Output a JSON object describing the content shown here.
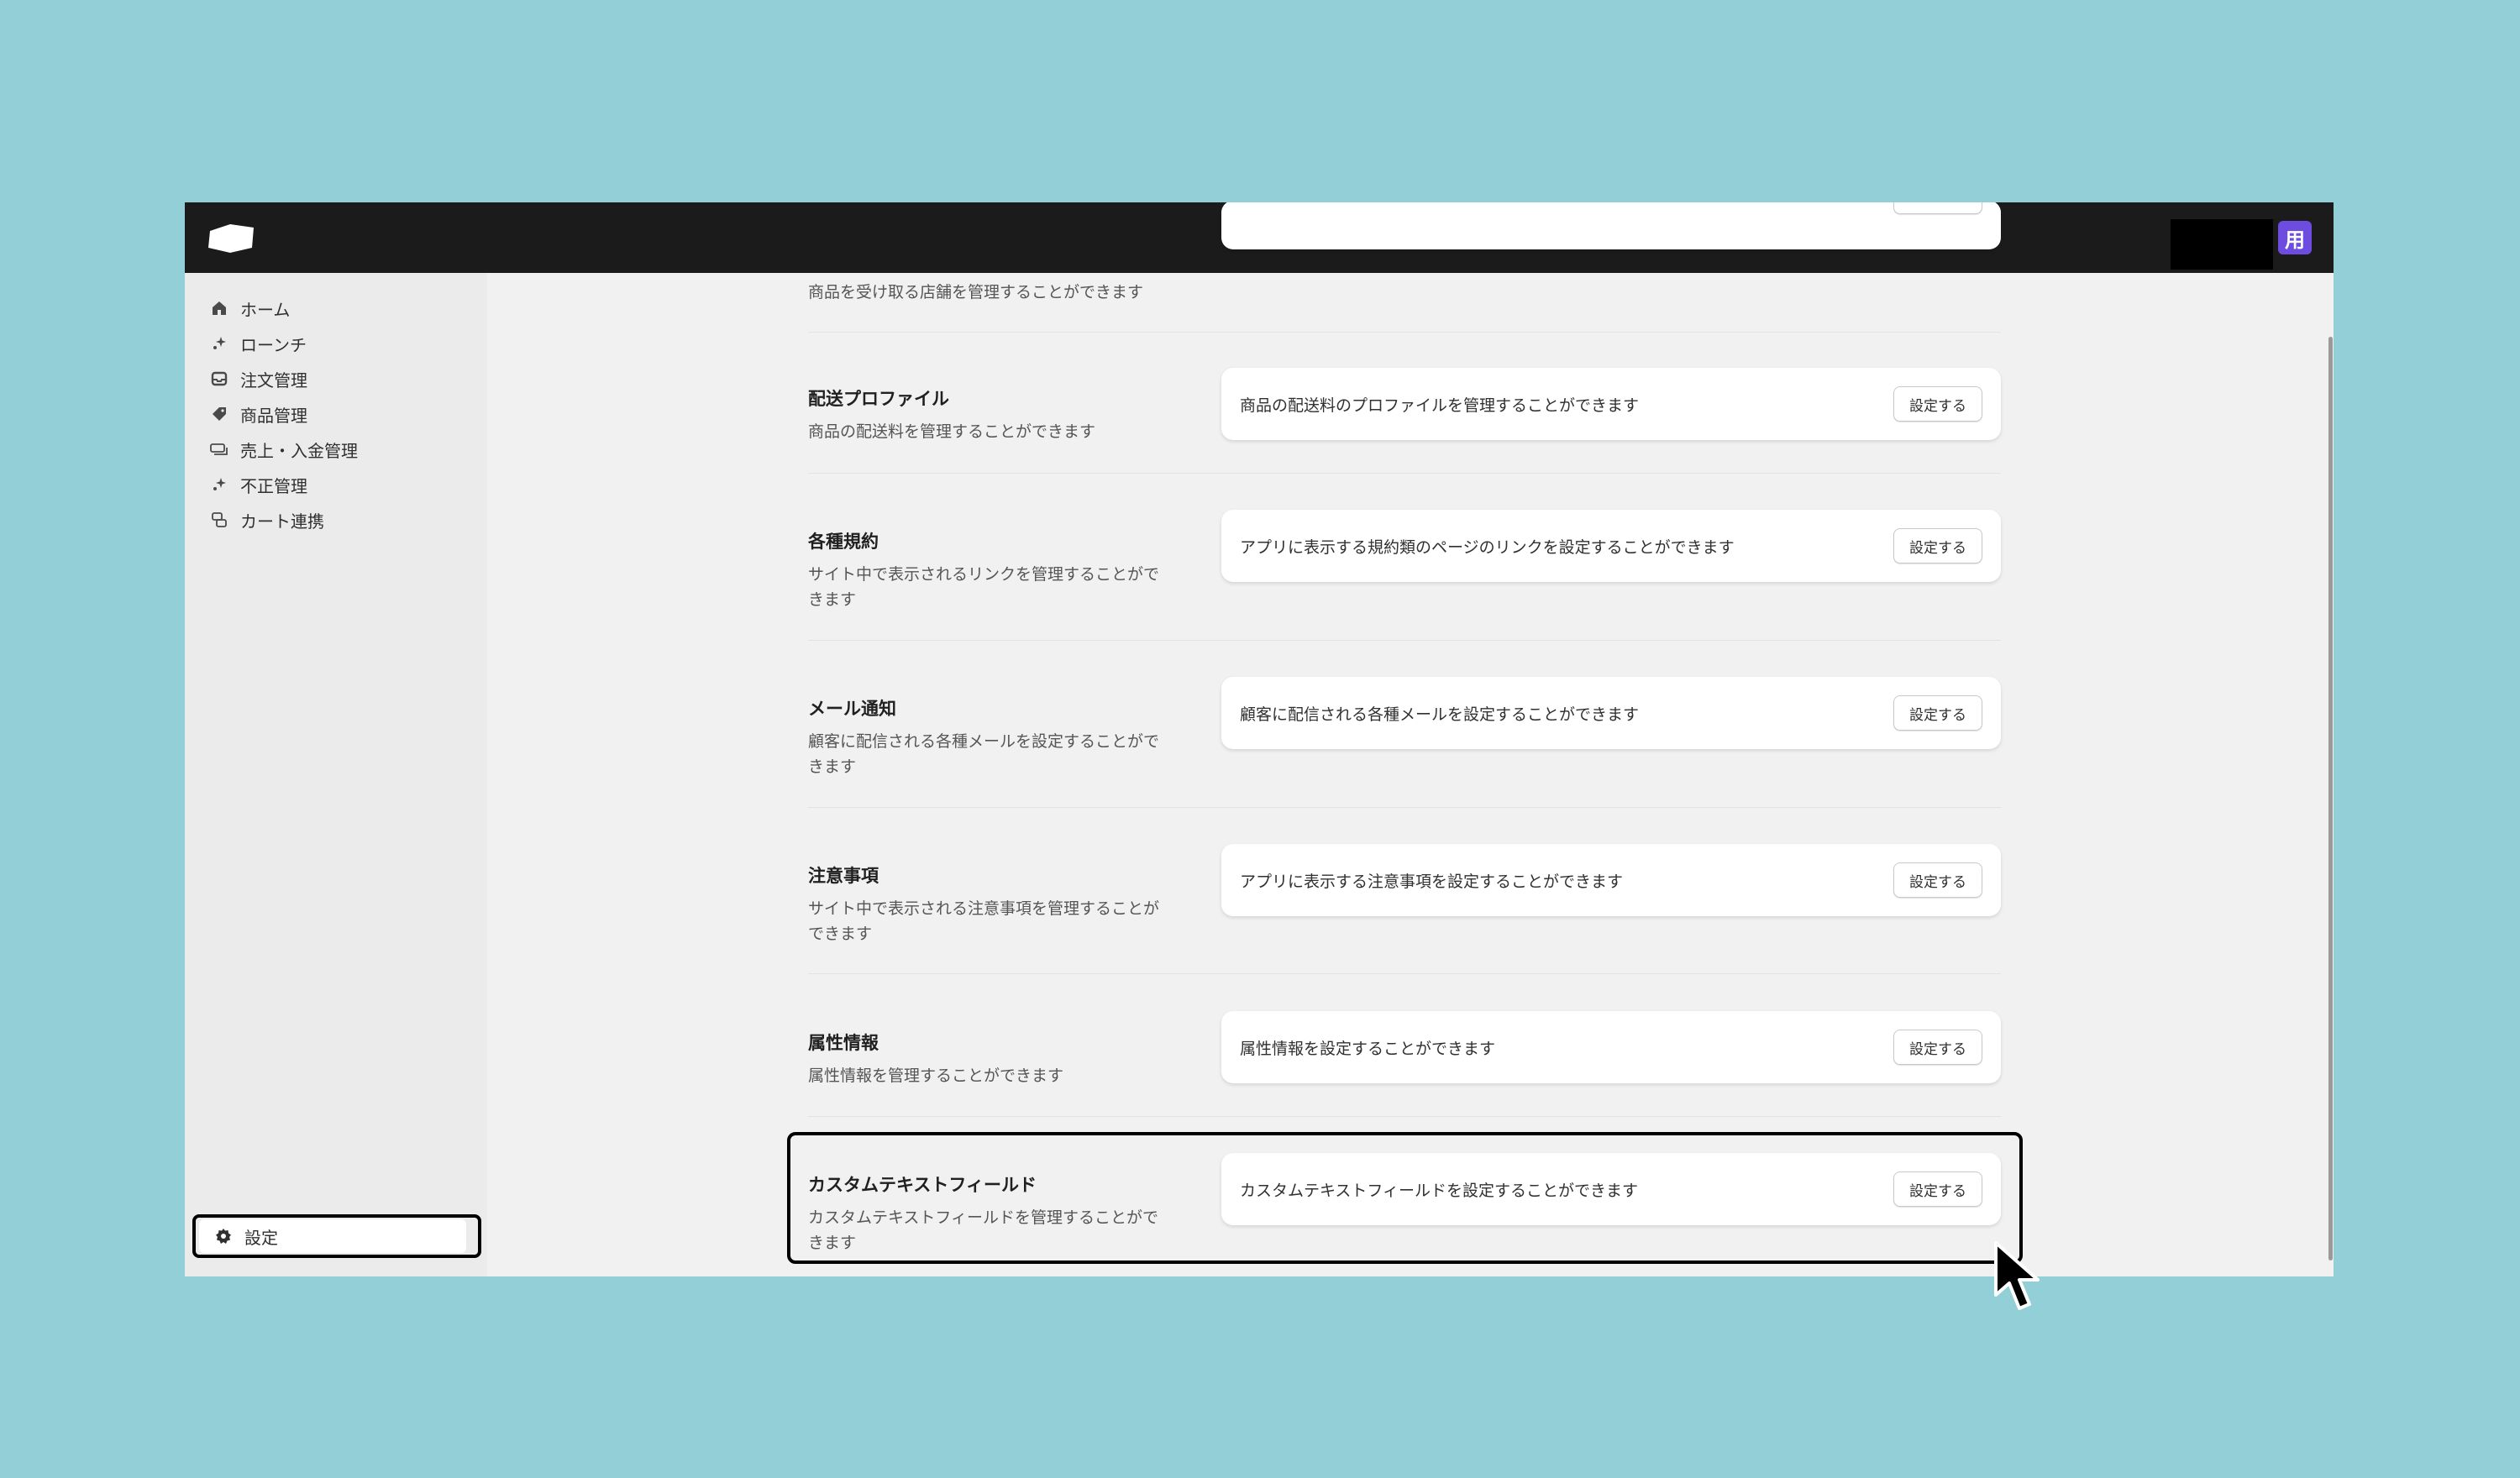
{
  "header": {
    "logo_icon": "shop-logo-icon",
    "store_avatar_label": "用"
  },
  "sidebar": {
    "items": [
      {
        "label": "ホーム",
        "icon": "home-icon"
      },
      {
        "label": "ローンチ",
        "icon": "sparkle-icon"
      },
      {
        "label": "注文管理",
        "icon": "inbox-icon"
      },
      {
        "label": "商品管理",
        "icon": "tag-icon"
      },
      {
        "label": "売上・入金管理",
        "icon": "money-icon"
      },
      {
        "label": "不正管理",
        "icon": "sparkle-icon"
      },
      {
        "label": "カート連携",
        "icon": "link-icon"
      }
    ],
    "settings_label": "設定"
  },
  "sections": [
    {
      "title": "",
      "desc": "商品を受け取る店舗を管理することができます",
      "card_text": "",
      "button": ""
    },
    {
      "title": "配送プロファイル",
      "desc": "商品の配送料を管理することができます",
      "card_text": "商品の配送料のプロファイルを管理することができます",
      "button": "設定する"
    },
    {
      "title": "各種規約",
      "desc": "サイト中で表示されるリンクを管理することがで きます",
      "card_text": "アプリに表示する規約類のページのリンクを設定することができます",
      "button": "設定する"
    },
    {
      "title": "メール通知",
      "desc": "顧客に配信される各種メールを設定することがで きます",
      "card_text": "顧客に配信される各種メールを設定することができます",
      "button": "設定する"
    },
    {
      "title": "注意事項",
      "desc": "サイト中で表示される注意事項を管理することが できます",
      "card_text": "アプリに表示する注意事項を設定することができます",
      "button": "設定する"
    },
    {
      "title": "属性情報",
      "desc": "属性情報を管理することができます",
      "card_text": "属性情報を設定することができます",
      "button": "設定する"
    },
    {
      "title": "カスタムテキストフィールド",
      "desc": "カスタムテキストフィールドを管理することがで きます",
      "card_text": "カスタムテキストフィールドを設定することができます",
      "button": "設定する"
    }
  ]
}
